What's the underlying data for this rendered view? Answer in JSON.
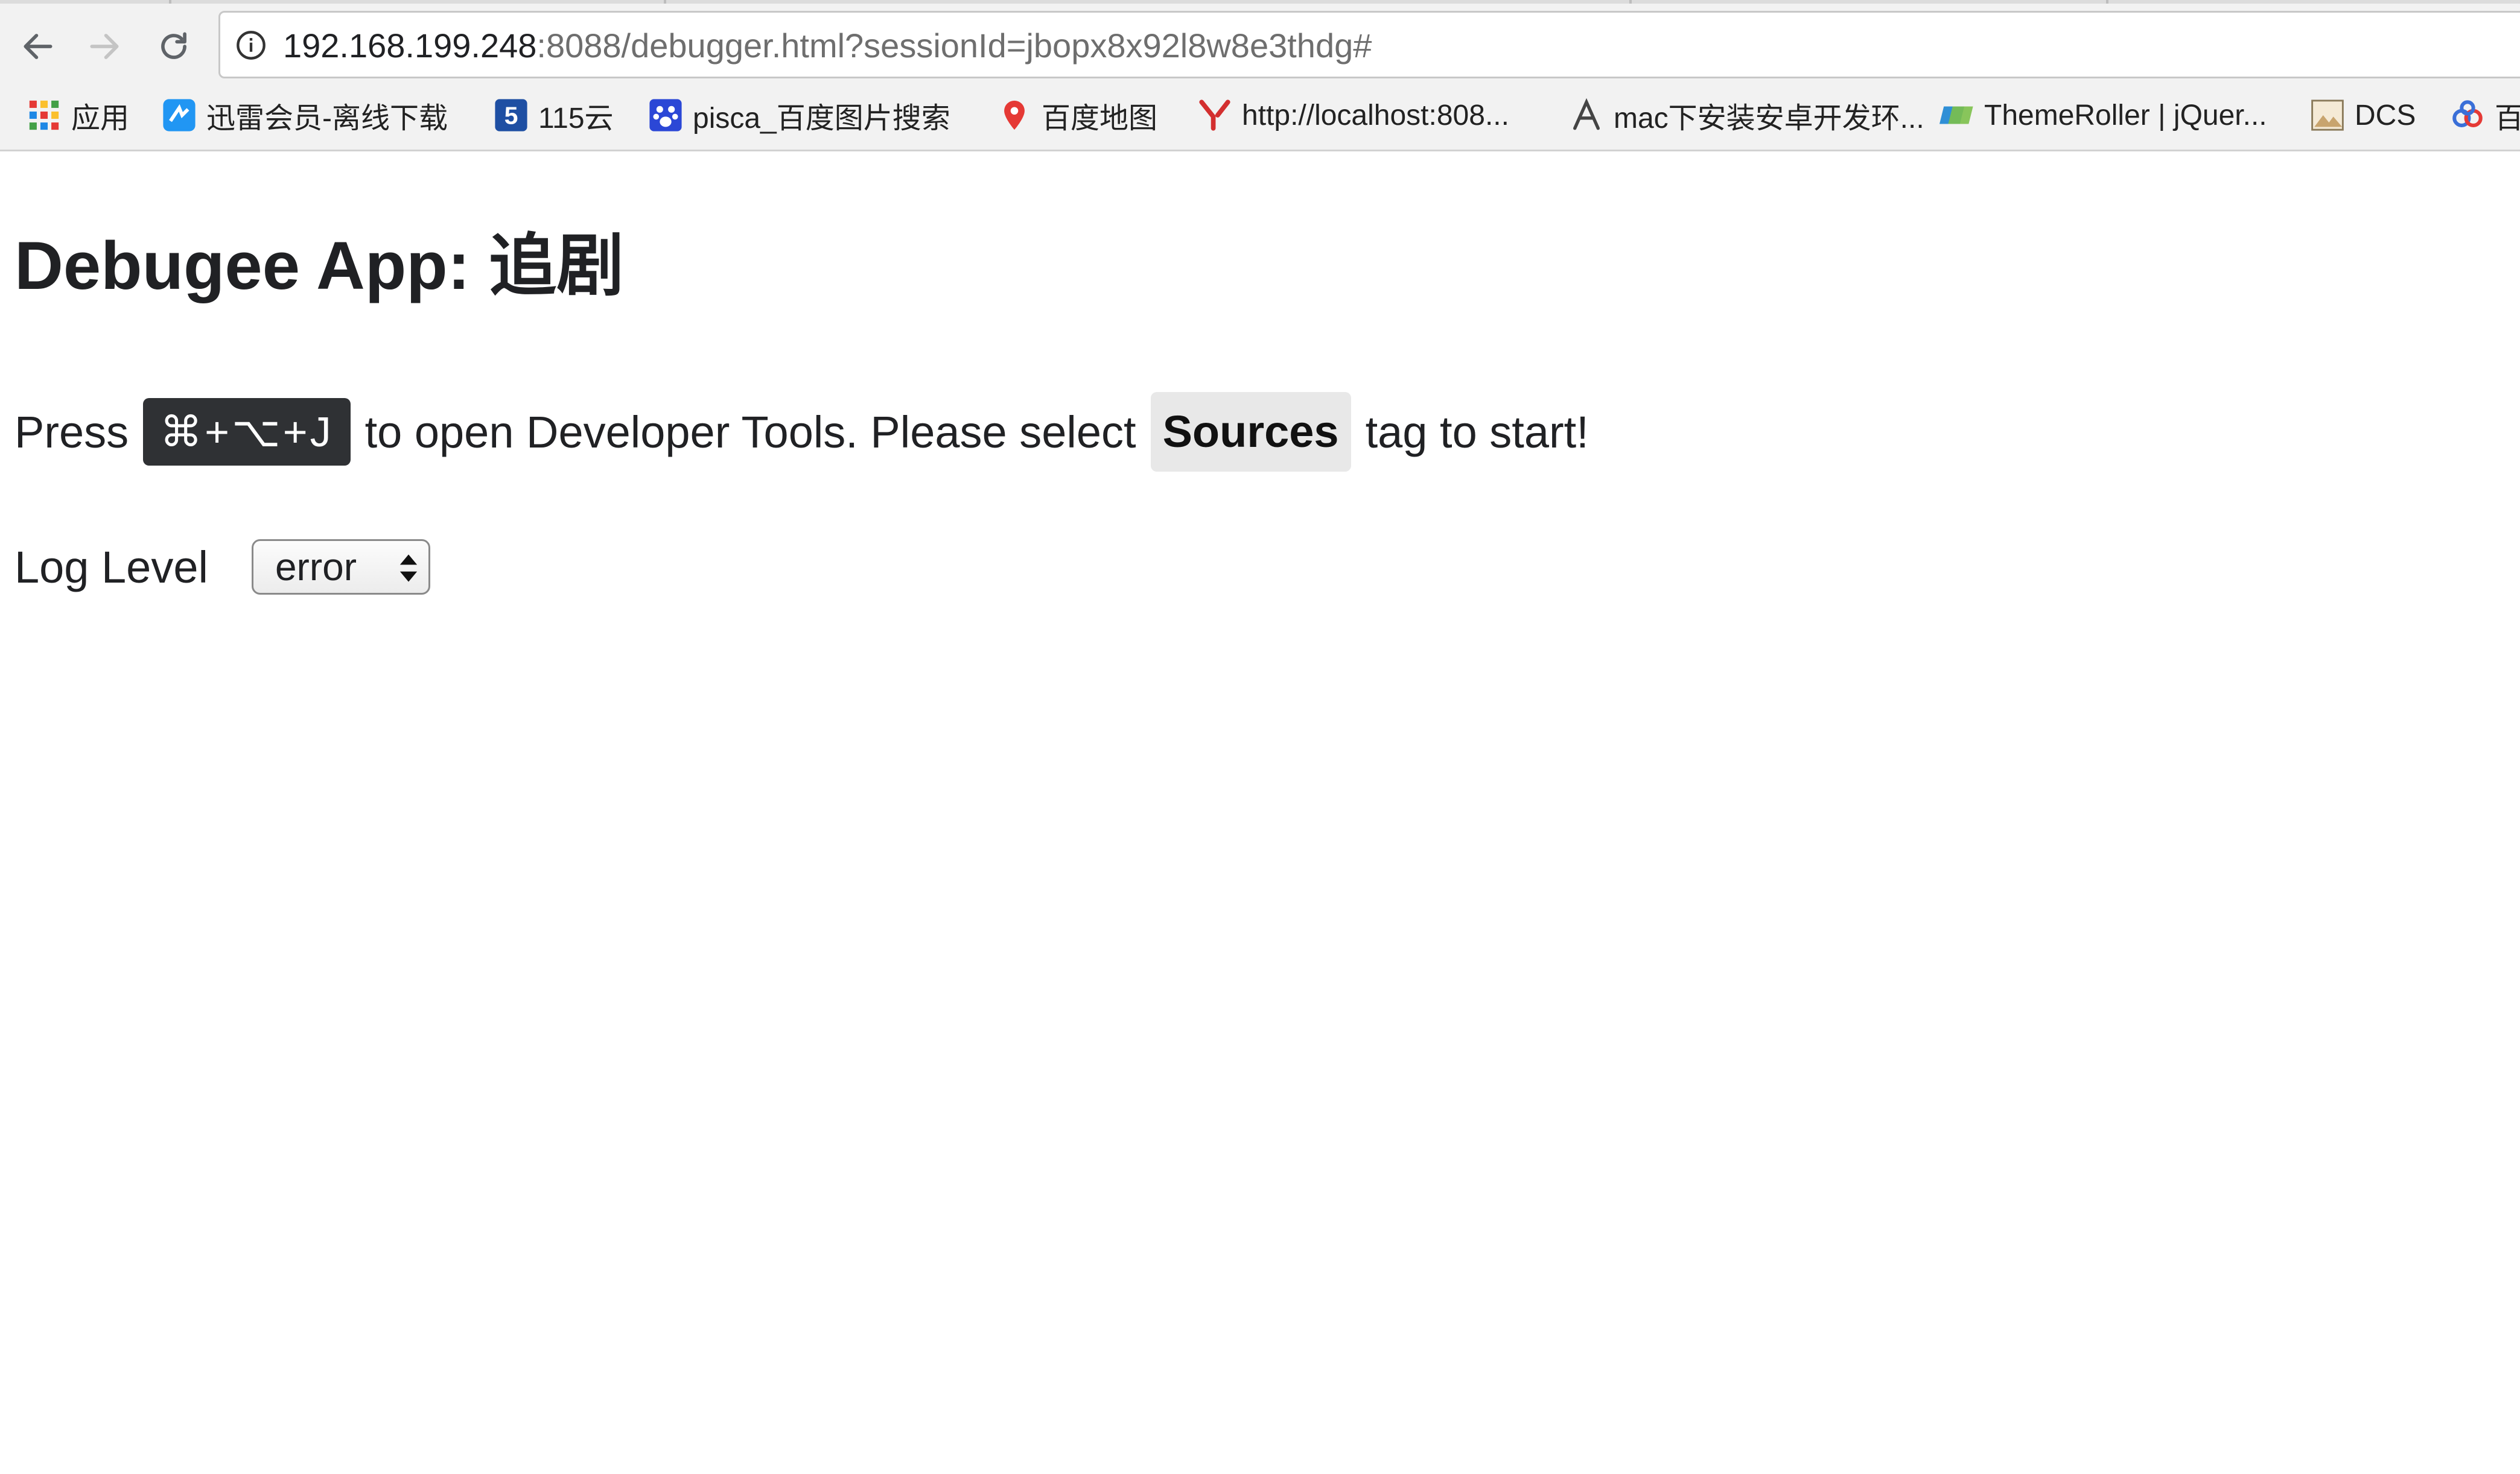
{
  "browser": {
    "url": {
      "host": "192.168.199.248",
      "rest": ":8088/debugger.html?sessionId=jbopx8x92l8w8e3thdg#"
    },
    "bookmarks": [
      {
        "label": "应用",
        "icon": "apps-grid-icon",
        "color": "#e53935"
      },
      {
        "label": "迅雷会员-离线下载",
        "icon": "xunlei-icon",
        "color": "#2196f3"
      },
      {
        "label": "115云",
        "icon": "cloud115-icon",
        "color": "#1e4fa3"
      },
      {
        "label": "pisca_百度图片搜索",
        "icon": "baidu-paw-icon",
        "color": "#2b47d6"
      },
      {
        "label": "百度地图",
        "icon": "map-pin-icon",
        "color": "#e53935"
      },
      {
        "label": "http://localhost:808...",
        "icon": "y-logo-icon",
        "color": "#d32f2f"
      },
      {
        "label": "mac下安装安卓开发环...",
        "icon": "a-logo-icon",
        "color": "#444444"
      },
      {
        "label": "ThemeRoller | jQuer...",
        "icon": "themeroller-icon",
        "color": "#2f8fd6"
      },
      {
        "label": "DCS",
        "icon": "dcs-image-icon",
        "color": "#c8a46e"
      },
      {
        "label": "百",
        "icon": "baidu-cloud-icon",
        "color": "#3a6fd8"
      }
    ]
  },
  "page": {
    "title": "Debugee App: 追剧",
    "instruction": {
      "prefix": "Press",
      "shortcut": "⌘+⌥+J",
      "middle": "to open Developer Tools. Please select",
      "tab_name": "Sources",
      "suffix": "tag to start!"
    },
    "log_level": {
      "label": "Log Level",
      "selected": "error"
    }
  }
}
